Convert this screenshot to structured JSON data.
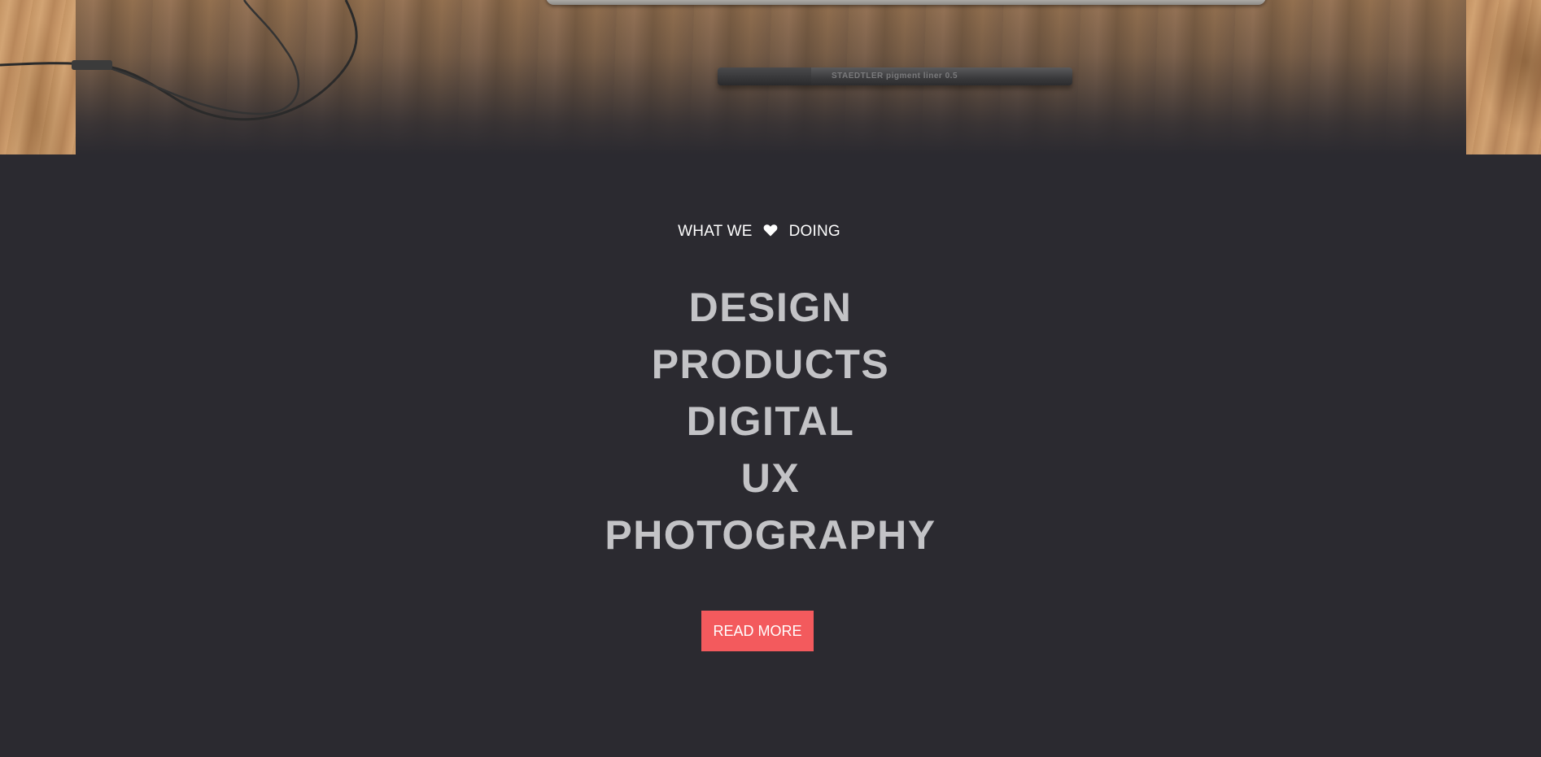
{
  "tagline": {
    "before": "WHAT WE",
    "icon": "heart-icon",
    "after": "DOING"
  },
  "services": [
    "DESIGN",
    "PRODUCTS",
    "DIGITAL",
    "UX",
    "PHOTOGRAPHY"
  ],
  "cta": {
    "label": "READ MORE"
  },
  "hero": {
    "pen_label": "STAEDTLER pigment liner 0.5"
  },
  "colors": {
    "background": "#2b2a30",
    "accent": "#f35a5d",
    "heading": "#c3c3c6",
    "text": "#ffffff"
  }
}
